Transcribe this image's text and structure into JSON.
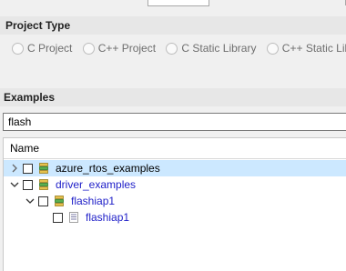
{
  "project_type": {
    "title": "Project Type",
    "options": [
      {
        "label": "C Project"
      },
      {
        "label": "C++ Project"
      },
      {
        "label": "C Static Library"
      },
      {
        "label": "C++ Static Libra"
      }
    ]
  },
  "examples": {
    "title": "Examples",
    "filter_value": "flash",
    "tree_header": "Name",
    "items": [
      {
        "label": "azure_rtos_examples",
        "expanded": false,
        "selected": true,
        "checked": false,
        "icon": "project-folder-icon"
      },
      {
        "label": "driver_examples",
        "expanded": true,
        "selected": false,
        "checked": false,
        "icon": "project-folder-icon"
      },
      {
        "label": "flashiap1",
        "expanded": true,
        "selected": false,
        "checked": false,
        "icon": "project-folder-icon"
      },
      {
        "label": "flashiap1",
        "selected": false,
        "checked": false,
        "icon": "example-file-icon"
      }
    ]
  },
  "colors": {
    "selection": "#cce8ff",
    "link_text": "#1e1ec8",
    "section_bar": "#e7e7e7"
  }
}
